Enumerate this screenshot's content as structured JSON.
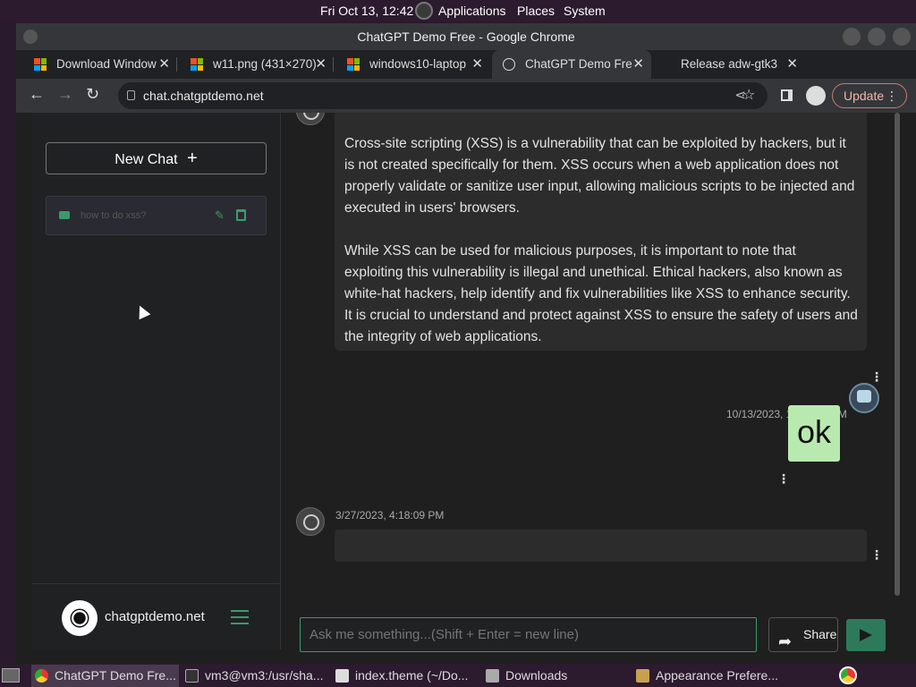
{
  "top_panel": {
    "clock": "Fri Oct 13, 12:42",
    "menus": [
      "Applications",
      "Places",
      "System"
    ]
  },
  "window": {
    "title": "ChatGPT Demo Free - Google Chrome"
  },
  "tabs": [
    {
      "label": "Download Window",
      "icon": "windows-logo-icon"
    },
    {
      "label": "w11.png (431×270)",
      "icon": "windows-logo-icon"
    },
    {
      "label": "windows10-laptop",
      "icon": "windows-logo-icon"
    },
    {
      "label": "ChatGPT Demo Fre",
      "icon": "globe-icon",
      "active": true
    },
    {
      "label": "Release adw-gtk3",
      "icon": "github-icon"
    }
  ],
  "toolbar": {
    "url": "chat.chatgptdemo.net",
    "update_label": "Update"
  },
  "sidebar": {
    "new_chat_label": "New Chat",
    "chats": [
      {
        "title": "how to do xss?"
      }
    ],
    "site_name": "chatgptdemo.net"
  },
  "conversation": {
    "bot_message": {
      "paragraphs": [
        "Cross-site scripting (XSS) is a vulnerability that can be exploited by hackers, but it is not created specifically for them. XSS occurs when a web application does not properly validate or sanitize user input, allowing malicious scripts to be injected and executed in users' browsers.",
        "While XSS can be used for malicious purposes, it is important to note that exploiting this vulnerability is illegal and unethical. Ethical hackers, also known as white-hat hackers, help identify and fix vulnerabilities like XSS to enhance security. It is crucial to understand and protect against XSS to ensure the safety of users and the integrity of web applications."
      ]
    },
    "user_message": {
      "timestamp": "10/13/2023, 12:41:56 PM",
      "text": "ok"
    },
    "bot_reply": {
      "timestamp": "3/27/2023, 4:18:09 PM",
      "text": ""
    }
  },
  "composer": {
    "placeholder": "Ask me something...(Shift + Enter = new line)",
    "share_label": "Share"
  },
  "taskbar": [
    {
      "label": "ChatGPT Demo Fre...",
      "active": true
    },
    {
      "label": "vm3@vm3:/usr/sha..."
    },
    {
      "label": "index.theme (~/Do..."
    },
    {
      "label": "Downloads"
    },
    {
      "label": "Appearance Prefere..."
    }
  ],
  "colors": {
    "accent": "#3c9a6a",
    "user_bubble": "#b8eab0",
    "update_border": "#c97a6c"
  }
}
